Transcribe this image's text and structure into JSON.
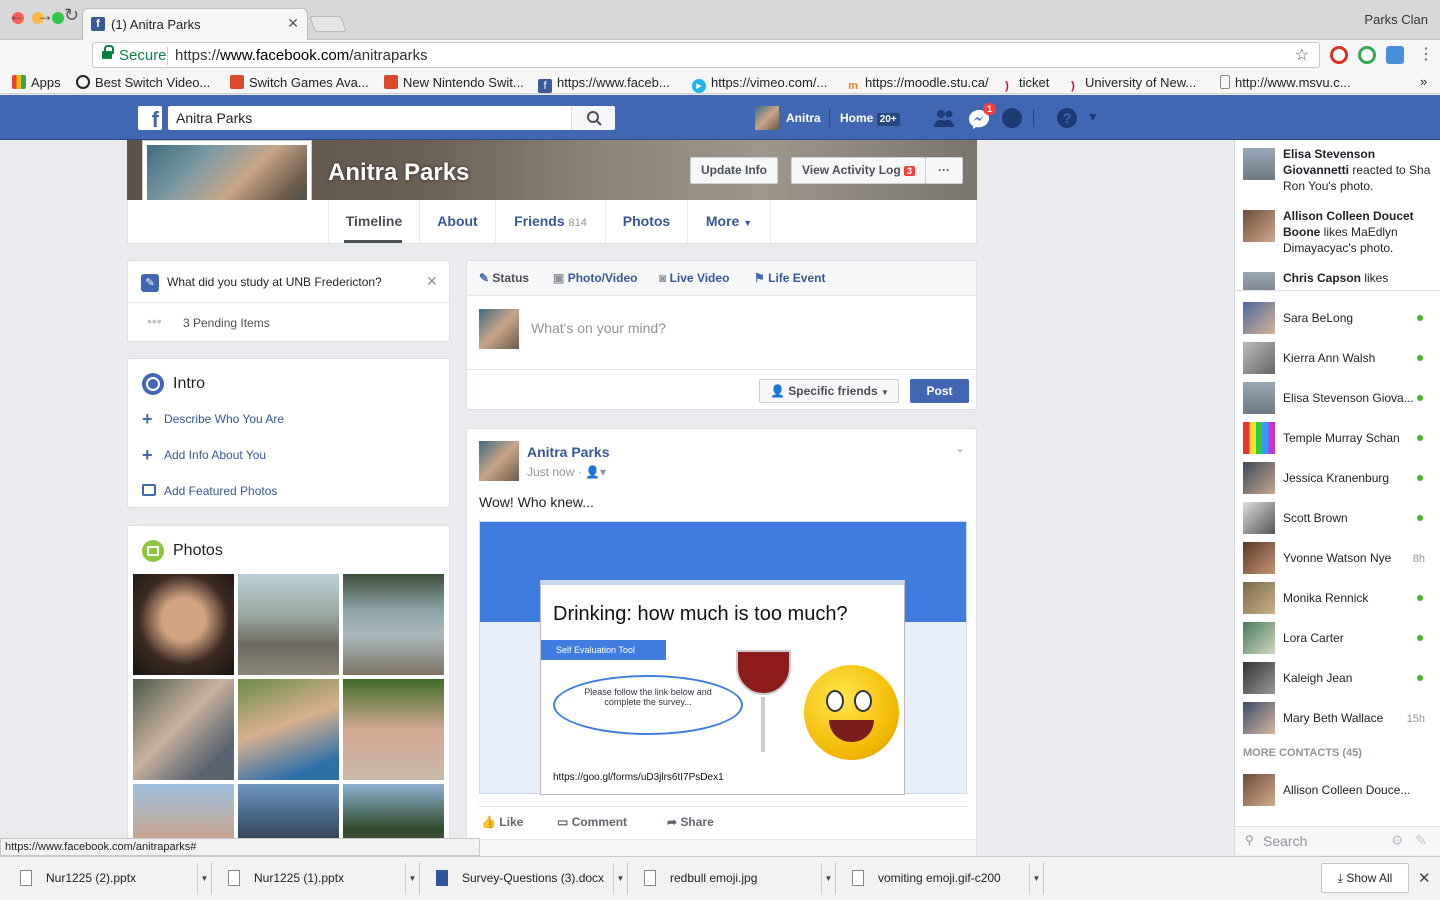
{
  "browser": {
    "tab_title": "(1) Anitra Parks",
    "profile_name": "Parks Clan",
    "secure_label": "Secure",
    "url_prefix": "https://",
    "url_host": "www.facebook.com",
    "url_path": "/anitraparks",
    "bookmarks": [
      {
        "label": "Apps",
        "icon": "apps-grid-icon"
      },
      {
        "label": "Best Switch Video...",
        "icon": "site-icon"
      },
      {
        "label": "Switch Games Ava...",
        "icon": "mario-icon"
      },
      {
        "label": "New Nintendo Swit...",
        "icon": "mario-icon"
      },
      {
        "label": "https://www.faceb...",
        "icon": "facebook-icon"
      },
      {
        "label": "https://vimeo.com/...",
        "icon": "vimeo-icon"
      },
      {
        "label": "https://moodle.stu.ca/",
        "icon": "moodle-icon"
      },
      {
        "label": "ticket",
        "icon": "unb-icon"
      },
      {
        "label": "University of New...",
        "icon": "unb-icon"
      },
      {
        "label": "http://www.msvu.c...",
        "icon": "page-icon"
      }
    ]
  },
  "fbheader": {
    "search_value": "Anitra Parks",
    "user_name": "Anitra",
    "home_label": "Home",
    "home_badge": "20+",
    "messages_badge": "1"
  },
  "profile": {
    "name": "Anitra Parks",
    "update_info": "Update Info",
    "activity_log": "View Activity Log",
    "activity_badge": "3",
    "more_dots": "···",
    "tabs": {
      "timeline": "Timeline",
      "about": "About",
      "friends": "Friends",
      "friends_count": "814",
      "photos": "Photos",
      "more": "More"
    }
  },
  "prompt": {
    "question": "What did you study at UNB Fredericton?",
    "pending": "3 Pending Items"
  },
  "intro": {
    "title": "Intro",
    "describe": "Describe Who You Are",
    "add_info": "Add Info About You",
    "featured": "Add Featured Photos"
  },
  "photos_card": {
    "title": "Photos"
  },
  "composer": {
    "status": "Status",
    "photo_video": "Photo/Video",
    "live_video": "Live Video",
    "life_event": "Life Event",
    "placeholder": "What's on your mind?",
    "audience": "Specific friends",
    "post": "Post"
  },
  "post": {
    "author": "Anitra Parks",
    "time": "Just now ·",
    "text": "Wow! Who knew...",
    "slide_title": "Drinking: how much is too much?",
    "slide_tag": "Self Evaluation Tool",
    "slide_bubble": "Please follow the link below and complete the survey...",
    "slide_link": "https://goo.gl/forms/uD3jlrs6tI7PsDex1",
    "like": "Like",
    "comment": "Comment",
    "share": "Share"
  },
  "ticker": [
    {
      "bold": "Elisa Stevenson Giovannetti",
      "rest": " reacted to Sha Ron You's photo."
    },
    {
      "bold": "Allison Colleen Doucet Boone",
      "rest": " likes MaEdlyn Dimayacyac's photo."
    },
    {
      "bold": "Chris Capson",
      "rest": " likes"
    }
  ],
  "contacts": [
    {
      "name": "Sara BeLong",
      "status": "online"
    },
    {
      "name": "Kierra Ann Walsh",
      "status": "online"
    },
    {
      "name": "Elisa Stevenson Giova...",
      "status": "online"
    },
    {
      "name": "Temple Murray Schan",
      "status": "online"
    },
    {
      "name": "Jessica Kranenburg",
      "status": "online"
    },
    {
      "name": "Scott Brown",
      "status": "online"
    },
    {
      "name": "Yvonne Watson Nye",
      "time": "8h"
    },
    {
      "name": "Monika Rennick",
      "status": "online"
    },
    {
      "name": "Lora Carter",
      "status": "online"
    },
    {
      "name": "Kaleigh Jean",
      "status": "online"
    },
    {
      "name": "Mary Beth Wallace",
      "time": "15h"
    }
  ],
  "more_contacts_label": "MORE CONTACTS (45)",
  "more_contact_first": "Allison Colleen Douce...",
  "sidebar_search": "Search",
  "status_url": "https://www.facebook.com/anitraparks#",
  "downloads": [
    {
      "name": "Nur1225 (2).pptx"
    },
    {
      "name": "Nur1225 (1).pptx"
    },
    {
      "name": "Survey-Questions (3).docx"
    },
    {
      "name": "redbull emoji.jpg"
    },
    {
      "name": "vomiting emoji.gif-c200"
    }
  ],
  "show_all": "Show All",
  "colors": {
    "fb_blue": "#4267b2",
    "link_blue": "#365899",
    "online_green": "#42b72a",
    "badge_red": "#fa3e3e"
  }
}
